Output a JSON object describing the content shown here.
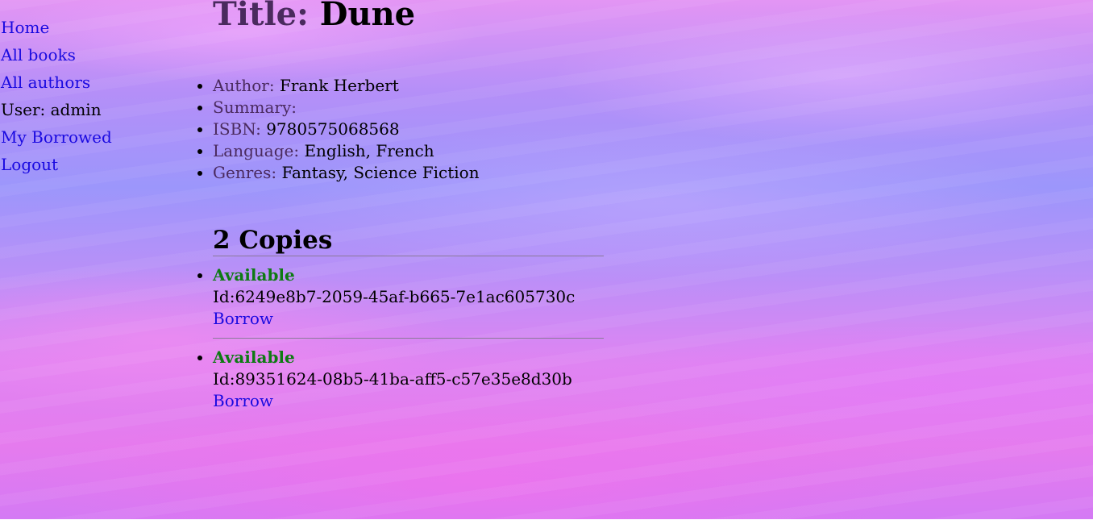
{
  "nav": {
    "home": "Home",
    "all_books": "All books",
    "all_authors": "All authors",
    "user": "User: admin",
    "my_borrowed": "My Borrowed",
    "logout": "Logout"
  },
  "book": {
    "title_label": "Title:",
    "title": "Dune",
    "author_label": "Author:",
    "author": "Frank Herbert",
    "summary_label": "Summary:",
    "isbn_label": "ISBN:",
    "isbn": "9780575068568",
    "language_label": "Language:",
    "language": "English, French",
    "genres_label": "Genres:",
    "genres": "Fantasy, Science Fiction"
  },
  "copies": {
    "heading": "2 Copies",
    "items": [
      {
        "status": "Available",
        "id": "Id:6249e8b7-2059-45af-b665-7e1ac605730c",
        "action": "Borrow"
      },
      {
        "status": "Available",
        "id": "Id:89351624-08b5-41ba-aff5-c57e35e8d30b",
        "action": "Borrow"
      }
    ]
  },
  "colors": {
    "link": "#1a0ae0",
    "available": "#0e7a14",
    "label": "#4a2a5e"
  }
}
